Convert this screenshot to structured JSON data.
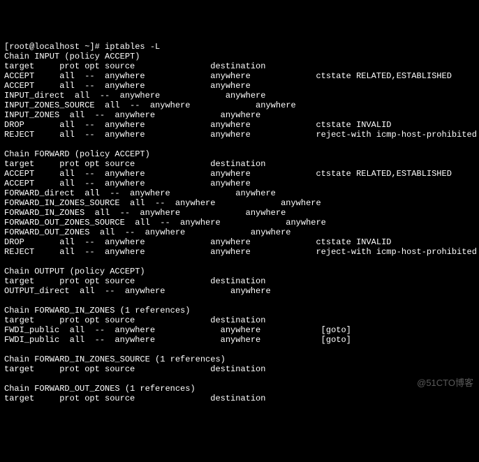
{
  "prompt": "[root@localhost ~]# ",
  "command": "iptables -L",
  "chains": [
    {
      "header": "Chain INPUT (policy ACCEPT)",
      "columns": "target     prot opt source               destination",
      "rules": [
        "ACCEPT     all  --  anywhere             anywhere             ctstate RELATED,ESTABLISHED",
        "ACCEPT     all  --  anywhere             anywhere",
        "INPUT_direct  all  --  anywhere             anywhere",
        "INPUT_ZONES_SOURCE  all  --  anywhere             anywhere",
        "INPUT_ZONES  all  --  anywhere             anywhere",
        "DROP       all  --  anywhere             anywhere             ctstate INVALID",
        "REJECT     all  --  anywhere             anywhere             reject-with icmp-host-prohibited"
      ]
    },
    {
      "header": "Chain FORWARD (policy ACCEPT)",
      "columns": "target     prot opt source               destination",
      "rules": [
        "ACCEPT     all  --  anywhere             anywhere             ctstate RELATED,ESTABLISHED",
        "ACCEPT     all  --  anywhere             anywhere",
        "FORWARD_direct  all  --  anywhere             anywhere",
        "FORWARD_IN_ZONES_SOURCE  all  --  anywhere             anywhere",
        "FORWARD_IN_ZONES  all  --  anywhere             anywhere",
        "FORWARD_OUT_ZONES_SOURCE  all  --  anywhere             anywhere",
        "FORWARD_OUT_ZONES  all  --  anywhere             anywhere",
        "DROP       all  --  anywhere             anywhere             ctstate INVALID",
        "REJECT     all  --  anywhere             anywhere             reject-with icmp-host-prohibited"
      ]
    },
    {
      "header": "Chain OUTPUT (policy ACCEPT)",
      "columns": "target     prot opt source               destination",
      "rules": [
        "OUTPUT_direct  all  --  anywhere             anywhere"
      ]
    },
    {
      "header": "Chain FORWARD_IN_ZONES (1 references)",
      "columns": "target     prot opt source               destination",
      "rules": [
        "FWDI_public  all  --  anywhere             anywhere            [goto]",
        "FWDI_public  all  --  anywhere             anywhere            [goto]"
      ]
    },
    {
      "header": "Chain FORWARD_IN_ZONES_SOURCE (1 references)",
      "columns": "target     prot opt source               destination",
      "rules": []
    },
    {
      "header": "Chain FORWARD_OUT_ZONES (1 references)",
      "columns": "target     prot opt source               destination",
      "rules": []
    }
  ],
  "watermark": "@51CTO博客"
}
